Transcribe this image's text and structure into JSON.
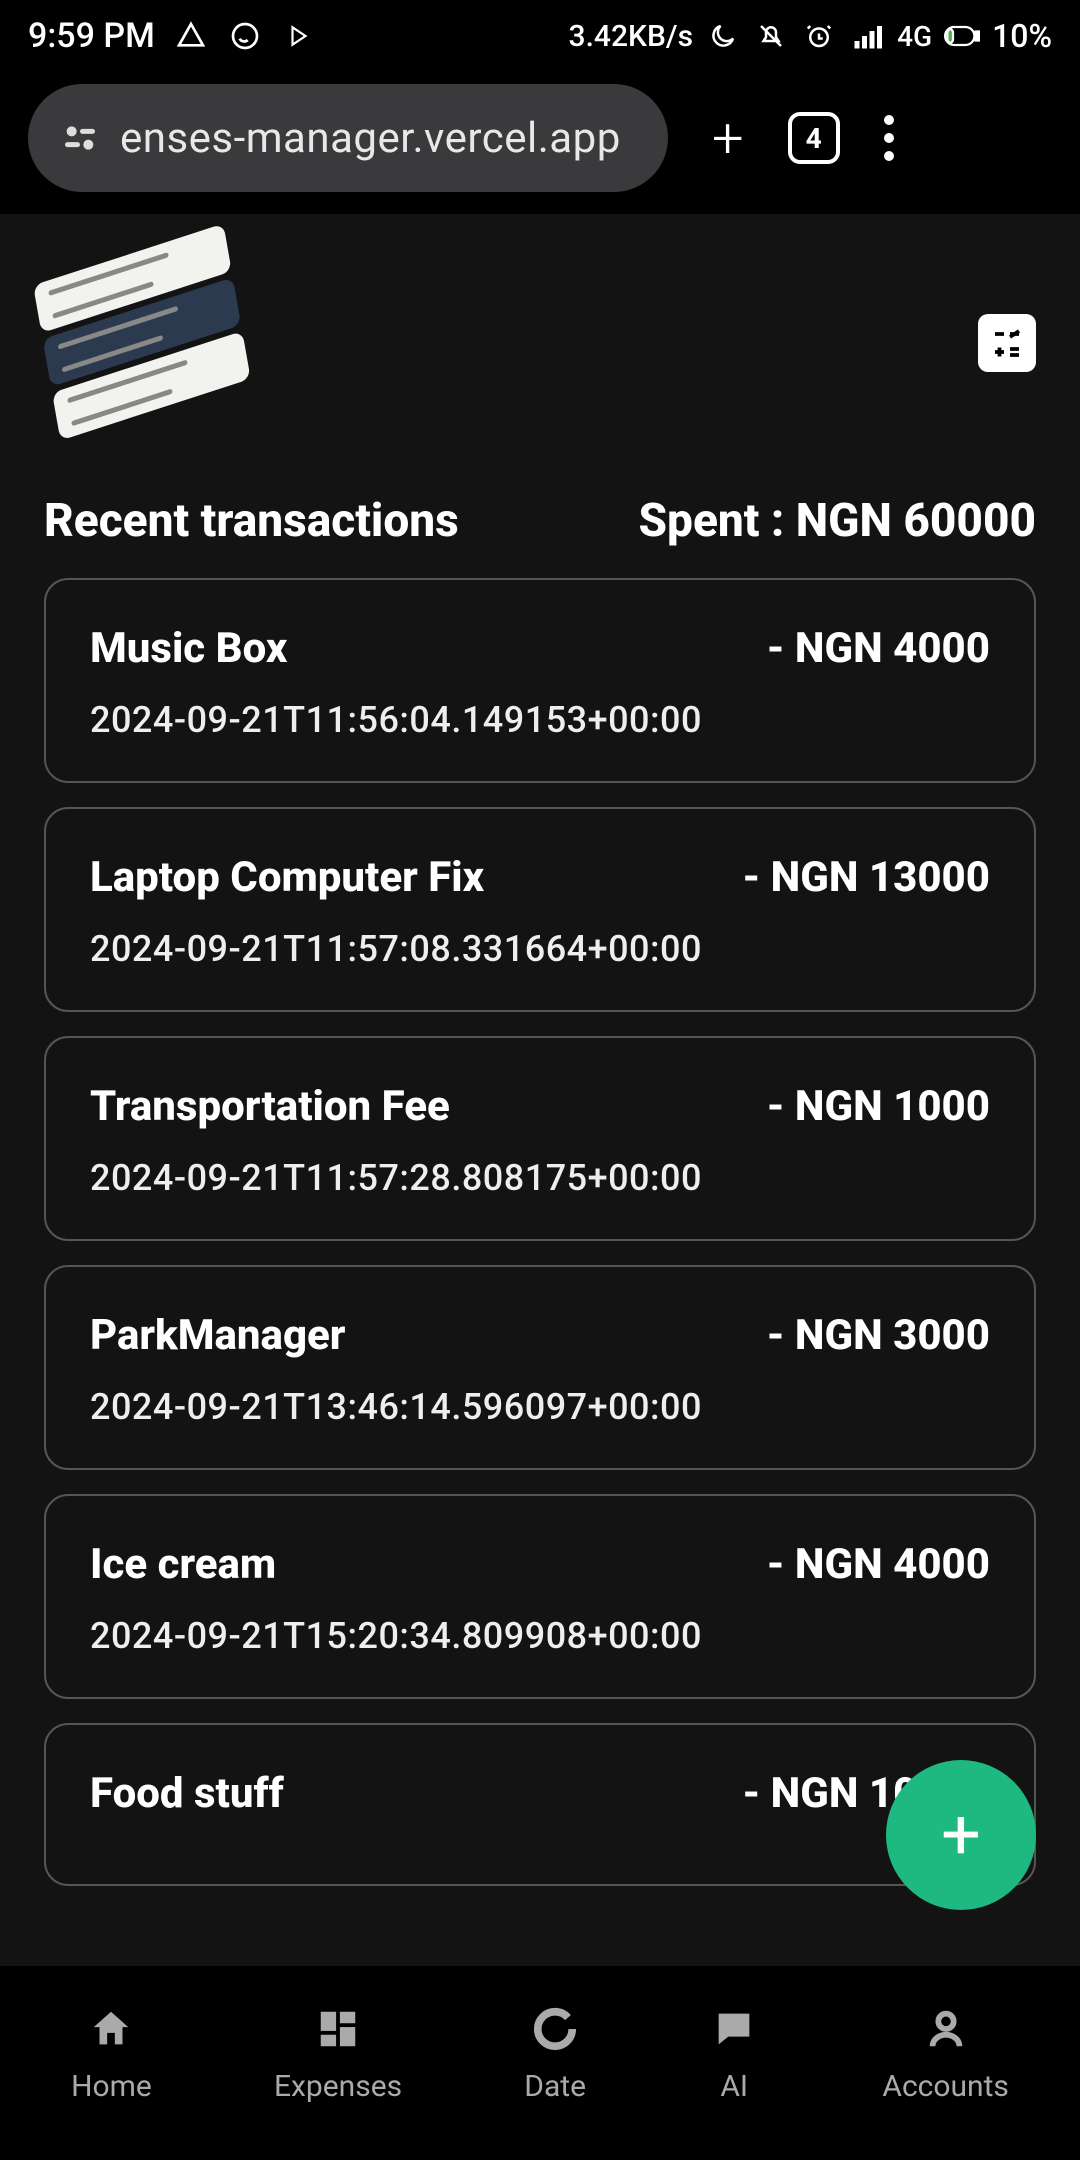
{
  "status": {
    "time": "9:59 PM",
    "speed": "3.42KB/s",
    "network": "4G",
    "battery": "10%"
  },
  "browser": {
    "url": "enses-manager.vercel.app",
    "tab_count": "4"
  },
  "app": {
    "calc_glyph": "−×\n+=",
    "recent_label": "Recent transactions",
    "spent_label": "Spent : NGN 60000"
  },
  "transactions": [
    {
      "title": "Music Box",
      "amount": "- NGN 4000",
      "date": "2024-09-21T11:56:04.149153+00:00"
    },
    {
      "title": "Laptop Computer Fix",
      "amount": "- NGN 13000",
      "date": "2024-09-21T11:57:08.331664+00:00"
    },
    {
      "title": "Transportation Fee",
      "amount": "- NGN 1000",
      "date": "2024-09-21T11:57:28.808175+00:00"
    },
    {
      "title": "ParkManager",
      "amount": "- NGN 3000",
      "date": "2024-09-21T13:46:14.596097+00:00"
    },
    {
      "title": "Ice cream",
      "amount": "- NGN 4000",
      "date": "2024-09-21T15:20:34.809908+00:00"
    },
    {
      "title": "Food stuff",
      "amount": "- NGN 10000",
      "date": ""
    }
  ],
  "fab": {
    "plus": "+"
  },
  "nav": {
    "home": "Home",
    "expenses": "Expenses",
    "date": "Date",
    "ai": "AI",
    "accounts": "Accounts"
  }
}
